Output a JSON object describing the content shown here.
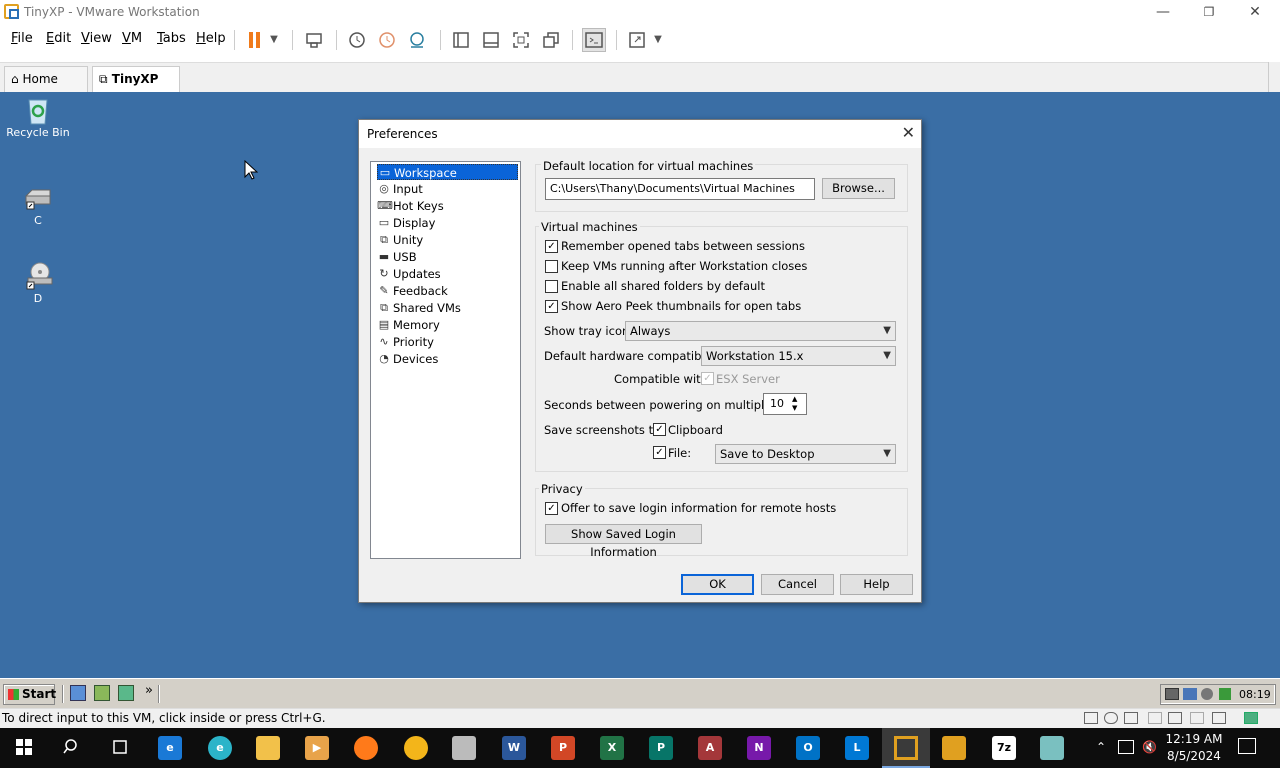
{
  "window": {
    "title": "TinyXP - VMware Workstation",
    "minimize": "—",
    "maximize": "❐",
    "close": "✕"
  },
  "menu": [
    {
      "key": "F",
      "rest": "ile"
    },
    {
      "key": "E",
      "rest": "dit"
    },
    {
      "key": "V",
      "rest": "iew"
    },
    {
      "key": "V",
      "rest": "M"
    },
    {
      "key": "T",
      "rest": "abs"
    },
    {
      "key": "H",
      "rest": "elp"
    }
  ],
  "tabs": [
    {
      "label": "Home",
      "close": "✕"
    },
    {
      "label": "TinyXP",
      "close": "✕"
    }
  ],
  "desktop_icons": [
    {
      "label": "Recycle Bin",
      "icon": "recycle-bin-icon"
    },
    {
      "label": "C",
      "icon": "hard-drive-icon"
    },
    {
      "label": "D",
      "icon": "cd-drive-icon"
    }
  ],
  "dialog": {
    "title": "Preferences",
    "nav": [
      "Workspace",
      "Input",
      "Hot Keys",
      "Display",
      "Unity",
      "USB",
      "Updates",
      "Feedback",
      "Shared VMs",
      "Memory",
      "Priority",
      "Devices"
    ],
    "default_location_label": "Default location for virtual machines",
    "default_location_value": "C:\\Users\\Thany\\Documents\\Virtual Machines",
    "browse": "Browse...",
    "vm_group": "Virtual machines",
    "checks": [
      {
        "label": "Remember opened tabs between sessions",
        "checked": true
      },
      {
        "label": "Keep VMs running after Workstation closes",
        "checked": false
      },
      {
        "label": "Enable all shared folders by default",
        "checked": false
      },
      {
        "label": "Show Aero Peek thumbnails for open tabs",
        "checked": true
      }
    ],
    "tray_label": "Show tray icon:",
    "tray_value": "Always",
    "hw_label": "Default hardware compatibility:",
    "hw_value": "Workstation 15.x",
    "compat_label": "Compatible with:",
    "compat_value": "ESX Server",
    "seconds_label": "Seconds between powering on multiple VMs:",
    "seconds_value": "10",
    "screenshots_label": "Save screenshots to:",
    "clipboard_label": "Clipboard",
    "file_label": "File:",
    "file_value": "Save to Desktop",
    "privacy_group": "Privacy",
    "offer_label": "Offer to save login information for remote hosts",
    "show_saved": "Show Saved Login Information",
    "ok": "OK",
    "cancel": "Cancel",
    "help": "Help"
  },
  "guest_taskbar": {
    "start": "Start",
    "chevron": "»",
    "time": "08:19"
  },
  "status": "To direct input to this VM, click inside or press Ctrl+G.",
  "host_taskbar": {
    "time": "12:19 AM",
    "date": "8/5/2024"
  }
}
